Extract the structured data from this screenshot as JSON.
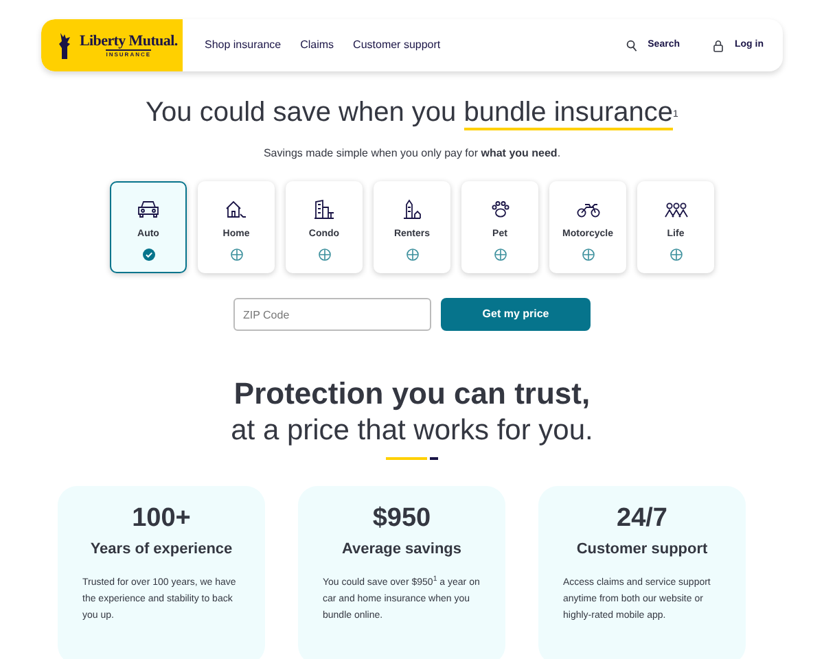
{
  "header": {
    "logo": {
      "name": "Liberty Mutual.",
      "tagline": "INSURANCE"
    },
    "nav": [
      "Shop insurance",
      "Claims",
      "Customer support"
    ],
    "actions": [
      {
        "kind": "search",
        "label": "Search"
      },
      {
        "kind": "login",
        "label": "Log in"
      }
    ]
  },
  "hero": {
    "headline": "You could save when you ",
    "highlight": "bundle insurance",
    "note": "1",
    "subtitle": "Savings made simple when you only pay for **what you need**."
  },
  "products": [
    {
      "kind": "auto",
      "label": "Auto",
      "selected": true
    },
    {
      "kind": "home",
      "label": "Home",
      "selected": false
    },
    {
      "kind": "condo",
      "label": "Condo",
      "selected": false
    },
    {
      "kind": "renters",
      "label": "Renters",
      "selected": false
    },
    {
      "kind": "pet",
      "label": "Pet",
      "selected": false
    },
    {
      "kind": "motorcycle",
      "label": "Motorcycle",
      "selected": false
    },
    {
      "kind": "life",
      "label": "Life",
      "selected": false
    }
  ],
  "quote": {
    "placeholder": "ZIP Code",
    "button": "Get my price"
  },
  "trust": {
    "title": "Protection you can trust,",
    "subtitle": "at a price that works for you."
  },
  "stats": [
    {
      "value": "100+",
      "label": "Years of experience",
      "body": "Trusted for over 100 years, we have the experience and stability to back you up."
    },
    {
      "value": "$950",
      "label": "Average savings",
      "body": "You could save over $950$^{1}$ a year on car and home insurance when you bundle online."
    },
    {
      "value": "24/7",
      "label": "Customer support",
      "body": "Access claims and service support anytime from both our website or highly-rated mobile app."
    }
  ]
}
